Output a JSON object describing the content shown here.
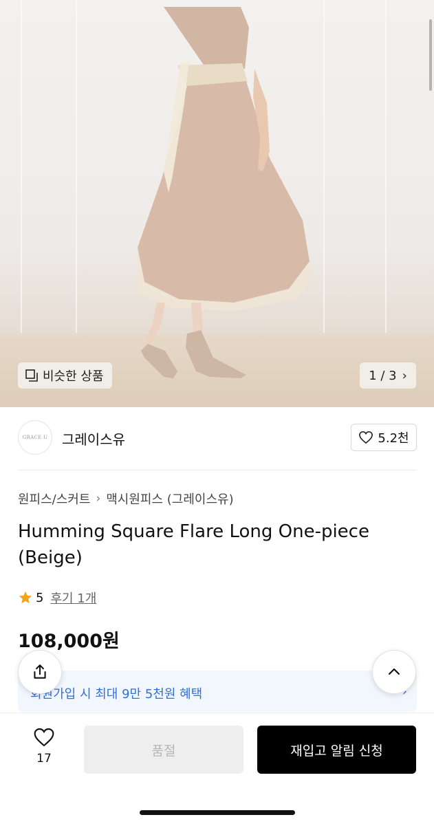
{
  "hero": {
    "similar_label": "비슷한 상품",
    "counter_label": "1 / 3"
  },
  "brand": {
    "logo_text": "GRACE U",
    "name": "그레이스유",
    "likes": "5.2천"
  },
  "breadcrumb": {
    "category": "원피스/스커트",
    "subcategory": "맥시원피스 (그레이스유)"
  },
  "product": {
    "title": "Humming Square Flare Long One-piece (Beige)",
    "rating": "5",
    "reviews": "후기 1개",
    "price": "108,000원"
  },
  "promo": {
    "text": "회원가입 시 최대 9만 5천원 혜택"
  },
  "bottom": {
    "wish_count": "17",
    "soldout_label": "품절",
    "restock_label": "재입고 알림 신청"
  },
  "colors": {
    "promo_blue": "#2f6fe0",
    "star": "#f2a51a",
    "primary_button": "#000000"
  },
  "icons": [
    "similar-products-icon",
    "chevron-right-icon",
    "heart-icon",
    "star-icon",
    "share-icon",
    "chevron-up-icon"
  ]
}
